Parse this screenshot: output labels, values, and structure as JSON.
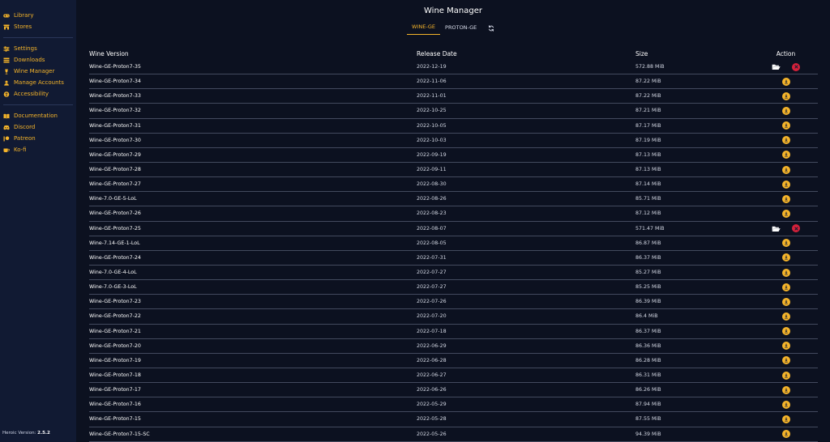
{
  "sidebar": {
    "groups": [
      [
        {
          "label": "Library",
          "icon": "gamepad-icon"
        },
        {
          "label": "Stores",
          "icon": "store-icon"
        }
      ],
      [
        {
          "label": "Settings",
          "icon": "sliders-icon"
        },
        {
          "label": "Downloads",
          "icon": "downloads-icon"
        },
        {
          "label": "Wine Manager",
          "icon": "wine-glass-icon"
        },
        {
          "label": "Manage Accounts",
          "icon": "user-icon"
        },
        {
          "label": "Accessibility",
          "icon": "accessibility-icon"
        }
      ],
      [
        {
          "label": "Documentation",
          "icon": "book-icon"
        },
        {
          "label": "Discord",
          "icon": "discord-icon"
        },
        {
          "label": "Patreon",
          "icon": "patreon-icon"
        },
        {
          "label": "Ko-fi",
          "icon": "coffee-icon"
        }
      ]
    ],
    "version_label": "Heroic Version:",
    "version_value": "2.5.2"
  },
  "header": {
    "title": "Wine Manager",
    "tabs": [
      {
        "label": "WINE-GE",
        "active": true
      },
      {
        "label": "PROTON-GE",
        "active": false
      }
    ]
  },
  "table": {
    "columns": [
      "Wine Version",
      "Release Date",
      "Size",
      "Action"
    ],
    "rows": [
      {
        "version": "Wine-GE-Proton7-35",
        "date": "2022-12-19",
        "size": "572.88 MiB",
        "installed": true
      },
      {
        "version": "Wine-GE-Proton7-34",
        "date": "2022-11-06",
        "size": "87.22 MiB",
        "installed": false
      },
      {
        "version": "Wine-GE-Proton7-33",
        "date": "2022-11-01",
        "size": "87.22 MiB",
        "installed": false
      },
      {
        "version": "Wine-GE-Proton7-32",
        "date": "2022-10-25",
        "size": "87.21 MiB",
        "installed": false
      },
      {
        "version": "Wine-GE-Proton7-31",
        "date": "2022-10-05",
        "size": "87.17 MiB",
        "installed": false
      },
      {
        "version": "Wine-GE-Proton7-30",
        "date": "2022-10-03",
        "size": "87.19 MiB",
        "installed": false
      },
      {
        "version": "Wine-GE-Proton7-29",
        "date": "2022-09-19",
        "size": "87.13 MiB",
        "installed": false
      },
      {
        "version": "Wine-GE-Proton7-28",
        "date": "2022-09-11",
        "size": "87.13 MiB",
        "installed": false
      },
      {
        "version": "Wine-GE-Proton7-27",
        "date": "2022-08-30",
        "size": "87.14 MiB",
        "installed": false
      },
      {
        "version": "Wine-7.0-GE-5-LoL",
        "date": "2022-08-26",
        "size": "85.71 MiB",
        "installed": false
      },
      {
        "version": "Wine-GE-Proton7-26",
        "date": "2022-08-23",
        "size": "87.12 MiB",
        "installed": false
      },
      {
        "version": "Wine-GE-Proton7-25",
        "date": "2022-08-07",
        "size": "571.47 MiB",
        "installed": true
      },
      {
        "version": "Wine-7.14-GE-1-LoL",
        "date": "2022-08-05",
        "size": "86.87 MiB",
        "installed": false
      },
      {
        "version": "Wine-GE-Proton7-24",
        "date": "2022-07-31",
        "size": "86.37 MiB",
        "installed": false
      },
      {
        "version": "Wine-7.0-GE-4-LoL",
        "date": "2022-07-27",
        "size": "85.27 MiB",
        "installed": false
      },
      {
        "version": "Wine-7.0-GE-3-LoL",
        "date": "2022-07-27",
        "size": "85.25 MiB",
        "installed": false
      },
      {
        "version": "Wine-GE-Proton7-23",
        "date": "2022-07-26",
        "size": "86.39 MiB",
        "installed": false
      },
      {
        "version": "Wine-GE-Proton7-22",
        "date": "2022-07-20",
        "size": "86.4 MiB",
        "installed": false
      },
      {
        "version": "Wine-GE-Proton7-21",
        "date": "2022-07-18",
        "size": "86.37 MiB",
        "installed": false
      },
      {
        "version": "Wine-GE-Proton7-20",
        "date": "2022-06-29",
        "size": "86.36 MiB",
        "installed": false
      },
      {
        "version": "Wine-GE-Proton7-19",
        "date": "2022-06-28",
        "size": "86.28 MiB",
        "installed": false
      },
      {
        "version": "Wine-GE-Proton7-18",
        "date": "2022-06-27",
        "size": "86.31 MiB",
        "installed": false
      },
      {
        "version": "Wine-GE-Proton7-17",
        "date": "2022-06-26",
        "size": "86.26 MiB",
        "installed": false
      },
      {
        "version": "Wine-GE-Proton7-16",
        "date": "2022-05-29",
        "size": "87.94 MiB",
        "installed": false
      },
      {
        "version": "Wine-GE-Proton7-15",
        "date": "2022-05-28",
        "size": "87.55 MiB",
        "installed": false
      },
      {
        "version": "Wine-GE-Proton7-15-SC",
        "date": "2022-05-26",
        "size": "94.39 MiB",
        "installed": false
      }
    ]
  },
  "colors": {
    "accent": "#f5b42a",
    "danger": "#d6213a",
    "background": "#0c1120",
    "sidebar": "#111a33"
  }
}
